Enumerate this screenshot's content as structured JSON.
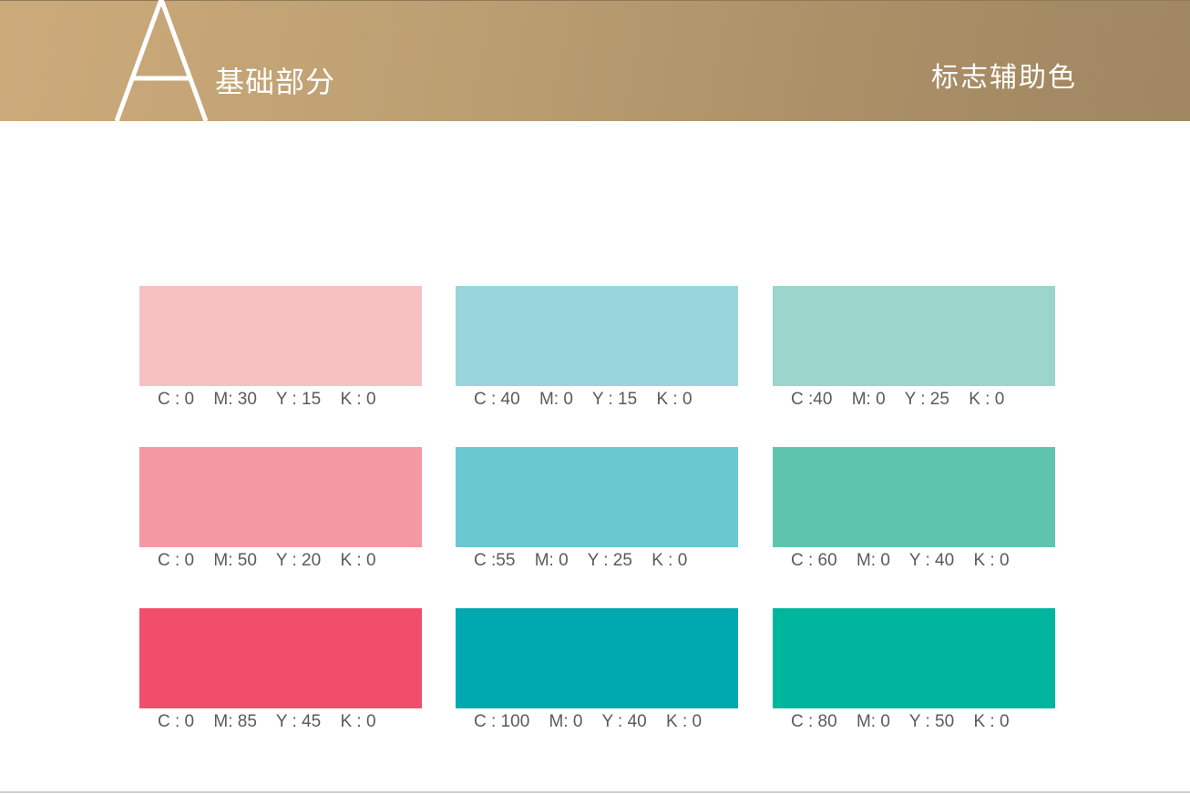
{
  "header": {
    "letter": "A",
    "section_title": "基础部分",
    "page_title": "标志辅助色"
  },
  "colors": {
    "header_gradient_start": "#cdaa7a",
    "header_gradient_end": "#a08762",
    "label_text": "#5a5a5a"
  },
  "swatches": [
    {
      "hex": "#f8c1c1",
      "c": "C : 0",
      "m": "M: 30",
      "y": "Y : 15",
      "k": "K : 0"
    },
    {
      "hex": "#98d6dc",
      "c": "C : 40",
      "m": "M: 0",
      "y": "Y : 15",
      "k": "K : 0"
    },
    {
      "hex": "#9bd5cb",
      "c": "C :40",
      "m": "M: 0",
      "y": "Y : 25",
      "k": "K : 0"
    },
    {
      "hex": "#f498a3",
      "c": "C : 0",
      "m": "M: 50",
      "y": "Y : 20",
      "k": "K : 0"
    },
    {
      "hex": "#69c8d0",
      "c": "C :55",
      "m": "M: 0",
      "y": "Y : 25",
      "k": "K : 0"
    },
    {
      "hex": "#5fc4ae",
      "c": "C : 60",
      "m": "M: 0",
      "y": "Y : 40",
      "k": "K : 0"
    },
    {
      "hex": "#f04e6b",
      "c": "C : 0",
      "m": "M: 85",
      "y": "Y : 45",
      "k": "K : 0"
    },
    {
      "hex": "#00a9b0",
      "c": "C : 100",
      "m": "M: 0",
      "y": "Y : 40",
      "k": "K : 0"
    },
    {
      "hex": "#00b59d",
      "c": "C : 80",
      "m": "M: 0",
      "y": "Y : 50",
      "k": "K : 0"
    }
  ]
}
